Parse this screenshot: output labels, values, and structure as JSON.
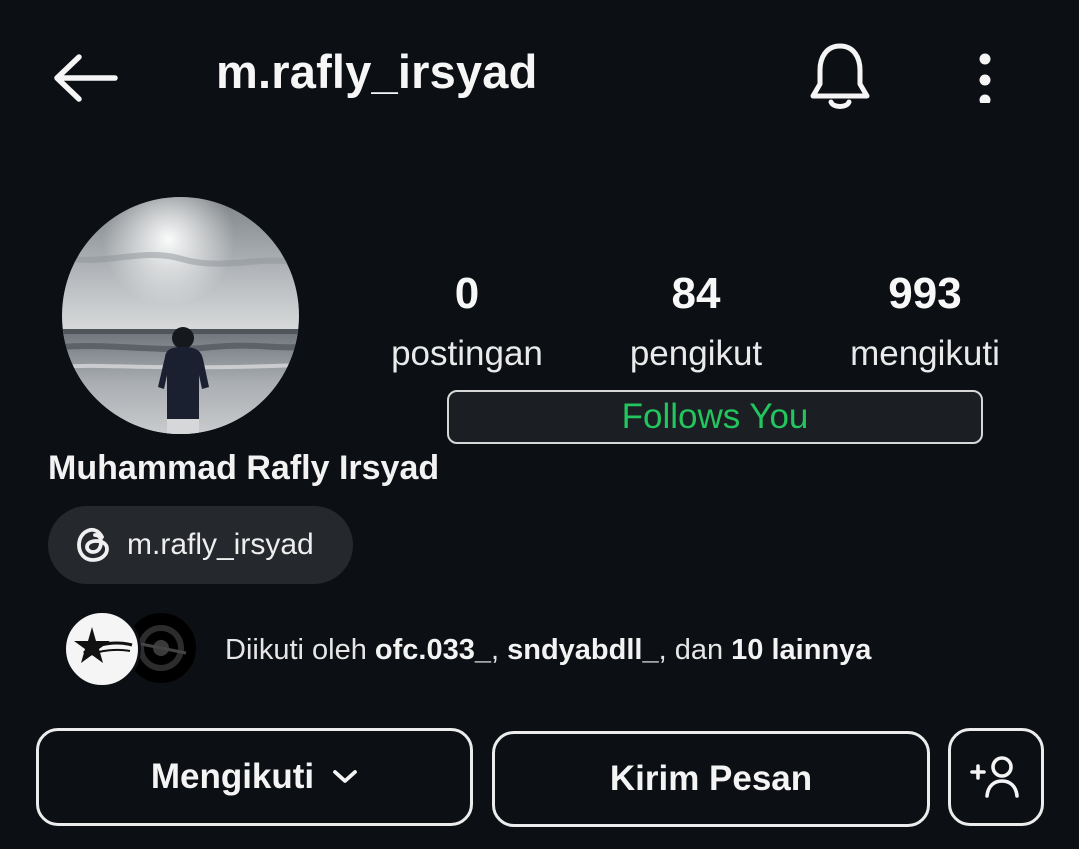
{
  "header": {
    "username": "m.rafly_irsyad",
    "back_icon": "arrow-left-icon",
    "bell_icon": "bell-icon",
    "more_icon": "more-vertical-icon"
  },
  "stats": [
    {
      "value": "0",
      "label": "postingan"
    },
    {
      "value": "84",
      "label": "pengikut"
    },
    {
      "value": "993",
      "label": "mengikuti"
    }
  ],
  "follows_you": "Follows You",
  "profile": {
    "display_name": "Muhammad Rafly Irsyad",
    "threads_handle": "m.rafly_irsyad"
  },
  "followed_by": {
    "prefix": "Diikuti oleh ",
    "user1": "ofc.033_",
    "sep": ", ",
    "user2": "sndyabdll_",
    "mid": ", dan ",
    "others": "10 lainnya"
  },
  "actions": {
    "following_label": "Mengikuti",
    "message_label": "Kirim Pesan"
  },
  "colors": {
    "background": "#0c0f14",
    "accent_green": "#22c55e",
    "chip_bg": "#25282d"
  }
}
